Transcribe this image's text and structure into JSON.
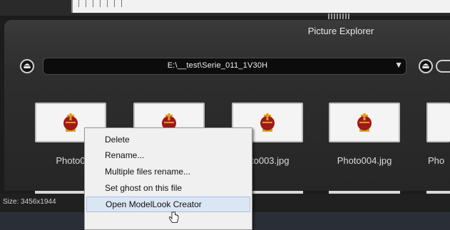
{
  "panel": {
    "title": "Picture Explorer",
    "left_button_icon": "folder-eject-icon",
    "right_button_icon": "folder-eject-icon"
  },
  "path_bar": {
    "value": "E:\\__test\\Serie_011_1V30H",
    "dropdown_icon": "triangle-down-icon"
  },
  "thumbnails": [
    {
      "caption": "Photo0"
    },
    {
      "caption": ""
    },
    {
      "caption": "to003.jpg"
    },
    {
      "caption": "Photo004.jpg"
    },
    {
      "caption": "Pho"
    }
  ],
  "status": {
    "text": "Size: 3456x1944"
  },
  "context_menu": {
    "items": [
      {
        "label": "Delete"
      },
      {
        "label": "Rename..."
      },
      {
        "label": "Multiple files rename..."
      },
      {
        "label": "Set ghost on this file"
      },
      {
        "label": "Open ModelLook Creator"
      }
    ],
    "hovered_index": 4
  },
  "colors": {
    "background": "#1c1c1c",
    "panel": "#2e2e2e",
    "menu_bg": "#f0f0f0",
    "menu_hover": "#dbe6f4",
    "crown_red": "#a01818",
    "crown_gold": "#d8a020"
  }
}
